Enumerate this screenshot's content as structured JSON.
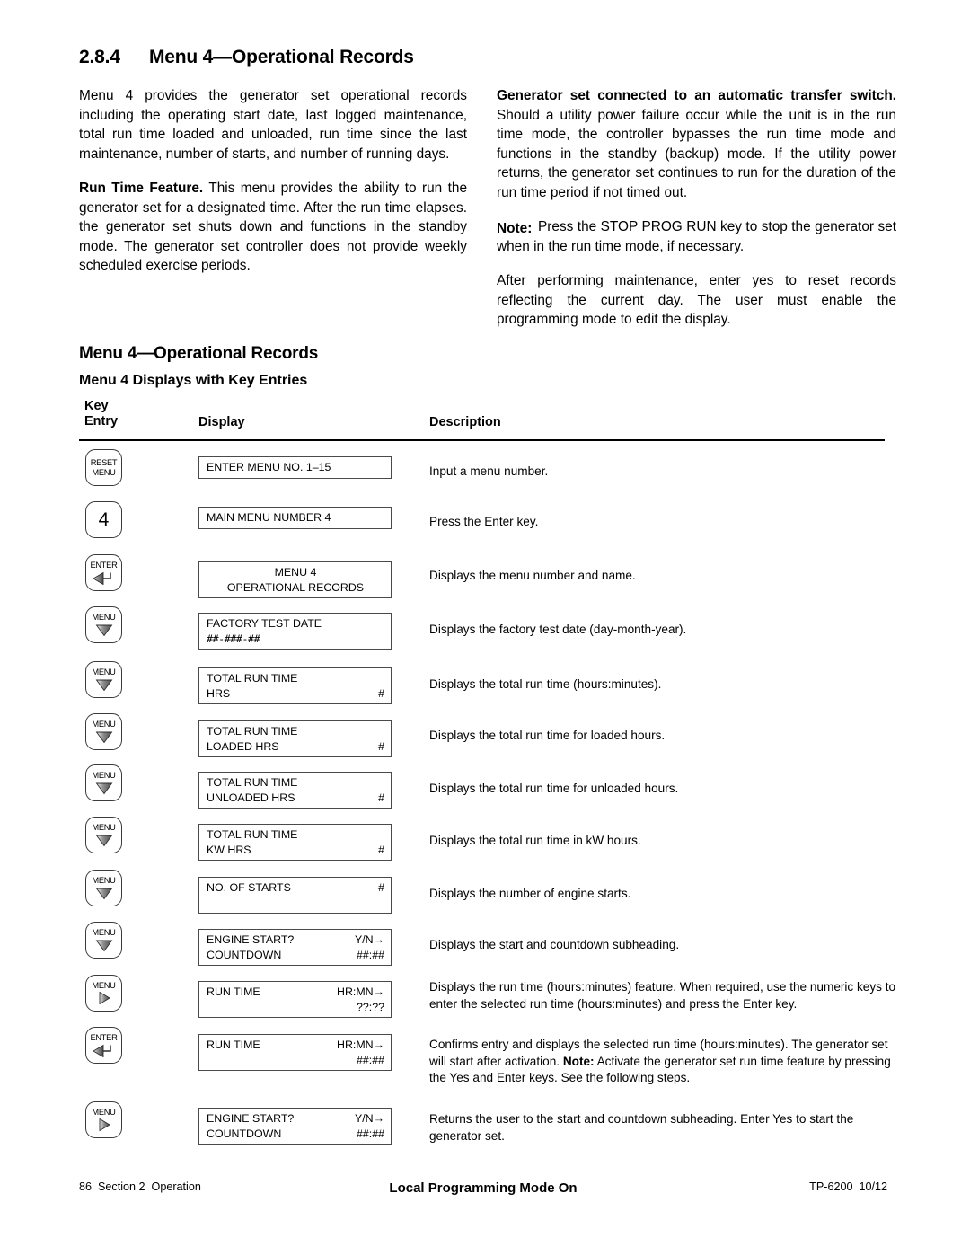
{
  "section": {
    "number": "2.8.4",
    "title": "Menu 4—Operational Records"
  },
  "left_column": {
    "para1": "Menu 4 provides the generator set operational records including the operating start date, last logged maintenance, total run time loaded and unloaded, run time since the last maintenance, number of starts, and number of running days.",
    "para2_bold": "Run Time Feature.",
    "para2": "This menu provides the ability to run the generator set for a designated time.  After the run time elapses. the generator set shuts down and functions in the standby mode.  The generator set controller does not provide weekly scheduled exercise periods."
  },
  "right_column": {
    "para1_bold": "Generator set connected to an automatic transfer switch.",
    "para1": "Should a utility power failure occur while the unit is in the run time mode, the controller bypasses the run time mode and functions in the standby (backup) mode. If the utility power returns, the generator set continues to run for the duration of the run time period if not timed out.",
    "note_label": "Note:",
    "note_text": "Press the STOP PROG RUN key to stop the generator set when in the run time mode, if necessary.",
    "para2": "After performing maintenance, enter yes to reset records reflecting the current day.  The user must enable the programming mode to edit the display."
  },
  "table": {
    "title": "Menu 4—Operational Records",
    "subtitle": "Menu 4 Displays with Key Entries",
    "headers": {
      "key_line1": "Key",
      "key_line2": "Entry",
      "display": "Display",
      "description": "Description"
    },
    "rows": [
      {
        "key": {
          "type": "label2",
          "line1": "RESET",
          "line2": "MENU"
        },
        "display": [
          {
            "left": "ENTER MENU NO. 1–15",
            "right": ""
          }
        ],
        "description": "Input a menu number."
      },
      {
        "key": {
          "type": "big",
          "text": "4"
        },
        "display": [
          {
            "left": "MAIN MENU NUMBER 4",
            "right": ""
          }
        ],
        "description": "Press the Enter key."
      },
      {
        "key": {
          "type": "enter",
          "label": "ENTER"
        },
        "display": [
          {
            "center": "MENU 4"
          },
          {
            "center": "OPERATIONAL RECORDS"
          }
        ],
        "description": " Displays the menu number and name."
      },
      {
        "key": {
          "type": "down",
          "label": "MENU"
        },
        "display": [
          {
            "left": "FACTORY TEST DATE",
            "right": ""
          },
          {
            "left": "##-###-##",
            "right": "",
            "mono": true
          }
        ],
        "description": "Displays the factory test date (day-month-year)."
      },
      {
        "key": {
          "type": "down",
          "label": "MENU"
        },
        "display": [
          {
            "left": "TOTAL RUN TIME",
            "right": ""
          },
          {
            "left": "HRS",
            "right": "#"
          }
        ],
        "description": "Displays the total run time (hours:minutes)."
      },
      {
        "key": {
          "type": "down",
          "label": "MENU"
        },
        "display": [
          {
            "left": "TOTAL RUN TIME",
            "right": ""
          },
          {
            "left": "LOADED HRS",
            "right": "#"
          }
        ],
        "description": "Displays the total run time for loaded hours."
      },
      {
        "key": {
          "type": "down",
          "label": "MENU"
        },
        "display": [
          {
            "left": "TOTAL RUN TIME",
            "right": ""
          },
          {
            "left": "UNLOADED HRS",
            "right": "#"
          }
        ],
        "description": "Displays the total run time for unloaded hours."
      },
      {
        "key": {
          "type": "down",
          "label": "MENU"
        },
        "display": [
          {
            "left": "TOTAL RUN TIME",
            "right": ""
          },
          {
            "left": "KW HRS",
            "right": "#"
          }
        ],
        "description": "Displays the total run time in kW hours."
      },
      {
        "key": {
          "type": "down",
          "label": "MENU"
        },
        "display": [
          {
            "left": "NO. OF STARTS",
            "right": "#"
          },
          {
            "left": "",
            "right": ""
          }
        ],
        "description": "Displays the number of engine starts."
      },
      {
        "key": {
          "type": "down",
          "label": "MENU"
        },
        "display": [
          {
            "left": "ENGINE START?",
            "right": "Y/N→"
          },
          {
            "left": "COUNTDOWN",
            "right": "##:##"
          }
        ],
        "description": "Displays the start and countdown subheading."
      },
      {
        "key": {
          "type": "right",
          "label": "MENU"
        },
        "display": [
          {
            "left": "RUN TIME",
            "right": "HR:MN→"
          },
          {
            "left": "",
            "right": "??:??"
          }
        ],
        "description": "Displays the run time (hours:minutes) feature.  When required, use the numeric keys to enter the selected run time (hours:minutes) and press the Enter key."
      },
      {
        "key": {
          "type": "enter",
          "label": "ENTER"
        },
        "display": [
          {
            "left": "RUN TIME",
            "right": "HR:MN→"
          },
          {
            "left": "",
            "right": "##:##"
          }
        ],
        "description_parts": [
          {
            "text": "Confirms entry and displays the selected run time (hours:minutes).  The generator set will start after activation.   ",
            "bold": false
          },
          {
            "text": "Note:",
            "bold": true
          },
          {
            "text": " Activate the generator set run time feature by pressing the Yes and Enter keys.  See the following steps.",
            "bold": false
          }
        ]
      },
      {
        "key": {
          "type": "right",
          "label": "MENU"
        },
        "display": [
          {
            "left": "ENGINE START?",
            "right": "Y/N→"
          },
          {
            "left": "COUNTDOWN",
            "right": "##:##"
          }
        ],
        "description": "Returns the user to the start and countdown subheading.  Enter Yes to start the generator set."
      }
    ]
  },
  "footer": {
    "page_number": "86",
    "section_label": "Section 2",
    "section_name": "Operation",
    "center": "Local Programming Mode On",
    "doc_id": "TP-6200",
    "doc_date": "10/12"
  }
}
